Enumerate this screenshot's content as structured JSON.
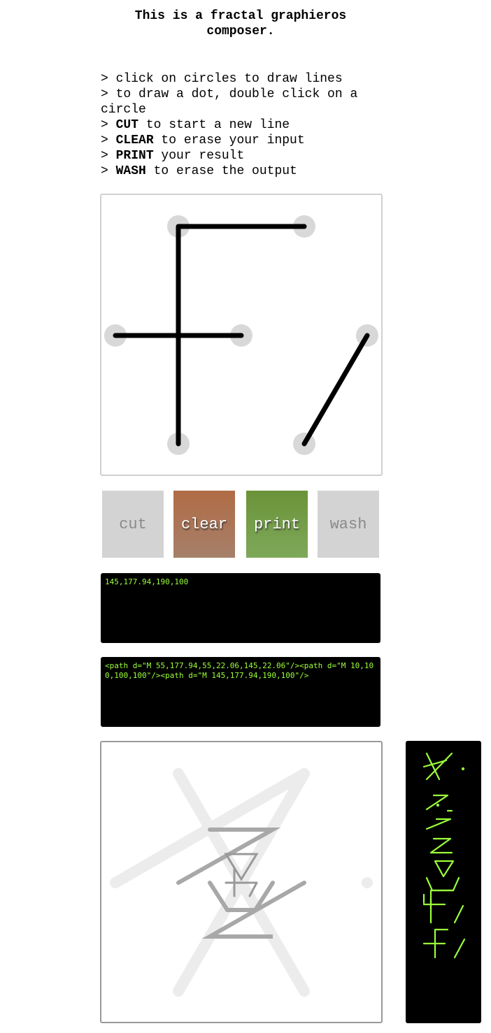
{
  "header": {
    "title": "This is a fractal graphieros composer."
  },
  "instructions": [
    {
      "prefix": "> ",
      "keyword": "",
      "text": "click on circles to draw lines"
    },
    {
      "prefix": "> ",
      "keyword": "",
      "text": "to draw a dot, double click on a circle"
    },
    {
      "prefix": "> ",
      "keyword": "CUT",
      "text": " to start a new line"
    },
    {
      "prefix": "> ",
      "keyword": "CLEAR",
      "text": " to erase your input"
    },
    {
      "prefix": "> ",
      "keyword": "PRINT",
      "text": " your result"
    },
    {
      "prefix": "> ",
      "keyword": "WASH",
      "text": " to erase the output"
    }
  ],
  "buttons": {
    "cut": "cut",
    "clear": "clear",
    "print": "print",
    "wash": "wash"
  },
  "consoles": {
    "coords": "145,177.94,190,100",
    "paths": "<path d=\"M 55,177.94,55,22.06,145,22.06\"/><path d=\"M 10,100,100,100\"/><path d=\"M 145,177.94,190,100\"/>"
  },
  "colors": {
    "clear_button": "#b06c45",
    "print_button": "#6a9339",
    "console_text": "#9cff3a",
    "glyph_output": "#9cff3a",
    "node": "#d8d8d8"
  }
}
